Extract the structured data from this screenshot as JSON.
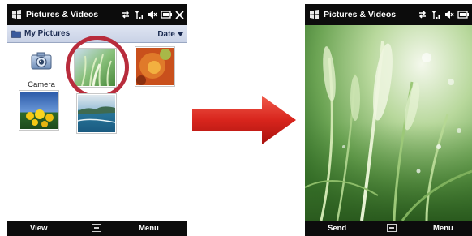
{
  "left_screen": {
    "statusbar": {
      "title": "Pictures & Videos"
    },
    "header": {
      "folder": "My Pictures",
      "sort": "Date"
    },
    "camera_tile": {
      "label": "Camera"
    },
    "softkeys": {
      "left": "View",
      "right": "Menu"
    }
  },
  "right_screen": {
    "statusbar": {
      "title": "Pictures & Videos"
    },
    "softkeys": {
      "left": "Send",
      "right": "Menu"
    }
  },
  "colors": {
    "bar_black": "#0c0c0c",
    "header_blue": "#c9d2e6",
    "highlight_ring": "#b82c3c",
    "arrow_red": "#d8251d"
  },
  "icons": [
    "windows-logo-icon",
    "connectivity-icon",
    "signal-icon",
    "volume-icon",
    "battery-icon",
    "close-icon",
    "folder-icon",
    "chevron-down-icon",
    "camera-icon",
    "keyboard-icon",
    "arrow-right-icon"
  ]
}
